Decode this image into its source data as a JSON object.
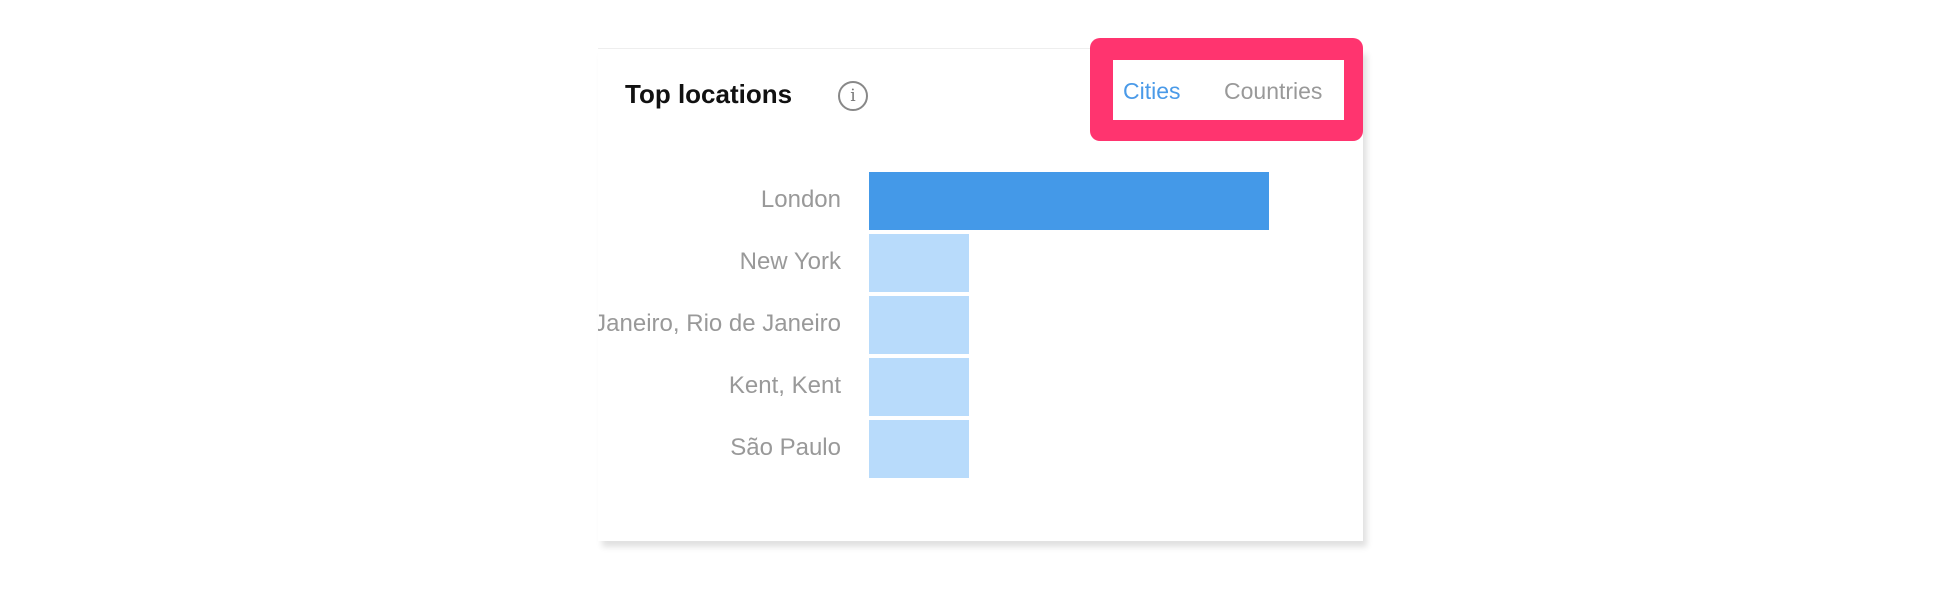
{
  "header": {
    "title": "Top locations",
    "info_icon": "info-icon"
  },
  "tabs": [
    {
      "label": "Cities",
      "active": true
    },
    {
      "label": "Countries",
      "active": false
    }
  ],
  "colors": {
    "highlight": "#ff346f",
    "bar_top": "#4499e8",
    "bar_other": "#b8dbfb",
    "active_tab": "#4a9ae8"
  },
  "chart_data": {
    "type": "bar",
    "orientation": "horizontal",
    "categories": [
      "London",
      "New York",
      "Rio de Janeiro, Rio de Janeiro",
      "Kent, Kent",
      "São Paulo"
    ],
    "values": [
      100,
      25,
      25,
      25,
      25
    ],
    "title": "Top locations",
    "xlabel": "",
    "ylabel": "",
    "grid": false
  }
}
